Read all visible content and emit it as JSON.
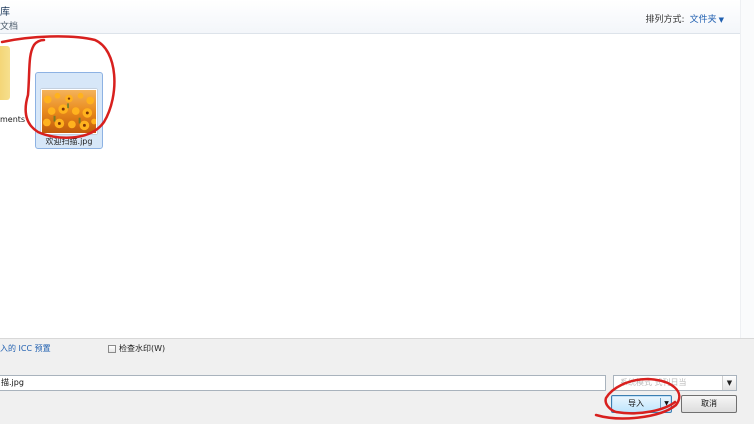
{
  "header": {
    "library_title": "库",
    "library_subtitle": "文档",
    "arrange_label": "排列方式:",
    "arrange_value": "文件夹"
  },
  "items": {
    "folder_label": "ments",
    "file_label": "欢迎扫描.jpg"
  },
  "options": {
    "icc_link": "入的 ICC 预置",
    "watermark_check": "检查水印(W)"
  },
  "bottom": {
    "filename_value": "描.jpg",
    "filetype_text": "系统模式 式刊日当",
    "import_label": "导入",
    "cancel_label": "取消"
  },
  "colors": {
    "link": "#1f5fb0",
    "selection_bg": "#d7e7f8",
    "annotation": "#d8201e"
  },
  "icons": {
    "dropdown": "chevron-down-icon",
    "folder": "folder-icon",
    "image_thumb": "image-thumbnail-icon"
  }
}
